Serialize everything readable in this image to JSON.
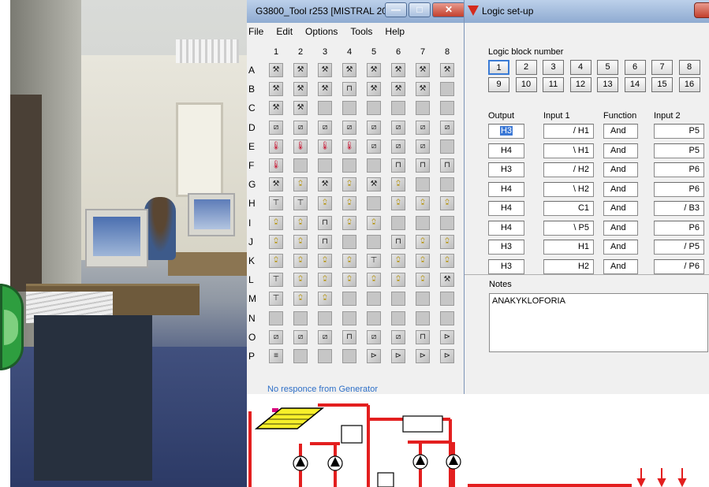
{
  "tool_window": {
    "title": "G3800_Tool r253 [MISTRAL 20...",
    "menu": [
      "File",
      "Edit",
      "Options",
      "Tools",
      "Help"
    ],
    "columns": [
      "1",
      "2",
      "3",
      "4",
      "5",
      "6",
      "7",
      "8"
    ],
    "rows": [
      "A",
      "B",
      "C",
      "D",
      "E",
      "F",
      "G",
      "H",
      "I",
      "J",
      "K",
      "L",
      "M",
      "N",
      "O",
      "P"
    ],
    "status": "No responce from Generator"
  },
  "logic_dialog": {
    "title": "Logic set-up",
    "block_label": "Logic block number",
    "block_numbers": [
      "1",
      "2",
      "3",
      "4",
      "5",
      "6",
      "7",
      "8",
      "9",
      "10",
      "11",
      "12",
      "13",
      "14",
      "15",
      "16"
    ],
    "selected_block": "1",
    "headers": {
      "output": "Output",
      "input1": "Input 1",
      "function": "Function",
      "input2": "Input 2"
    },
    "rows": [
      {
        "output": "H3",
        "input1": "/ H1",
        "function": "And",
        "input2": "P5"
      },
      {
        "output": "H4",
        "input1": "\\ H1",
        "function": "And",
        "input2": "P5"
      },
      {
        "output": "H3",
        "input1": "/ H2",
        "function": "And",
        "input2": "P6"
      },
      {
        "output": "H4",
        "input1": "\\ H2",
        "function": "And",
        "input2": "P6"
      },
      {
        "output": "H4",
        "input1": "C1",
        "function": "And",
        "input2": "/ B3"
      },
      {
        "output": "H4",
        "input1": "\\ P5",
        "function": "And",
        "input2": "P6"
      },
      {
        "output": "H3",
        "input1": "H1",
        "function": "And",
        "input2": "/ P5"
      },
      {
        "output": "H3",
        "input1": "H2",
        "function": "And",
        "input2": "/ P6"
      }
    ],
    "notes_label": "Notes",
    "notes_text": "ANAKYKLOFORIA"
  },
  "colors": {
    "title_bar": "#9fb9dc",
    "close_red": "#c3402d",
    "selection": "#3b78d6",
    "status_blue": "#2e6fc7",
    "pipe_red": "#e31f1f",
    "solar_yellow": "#f6ef2a"
  }
}
